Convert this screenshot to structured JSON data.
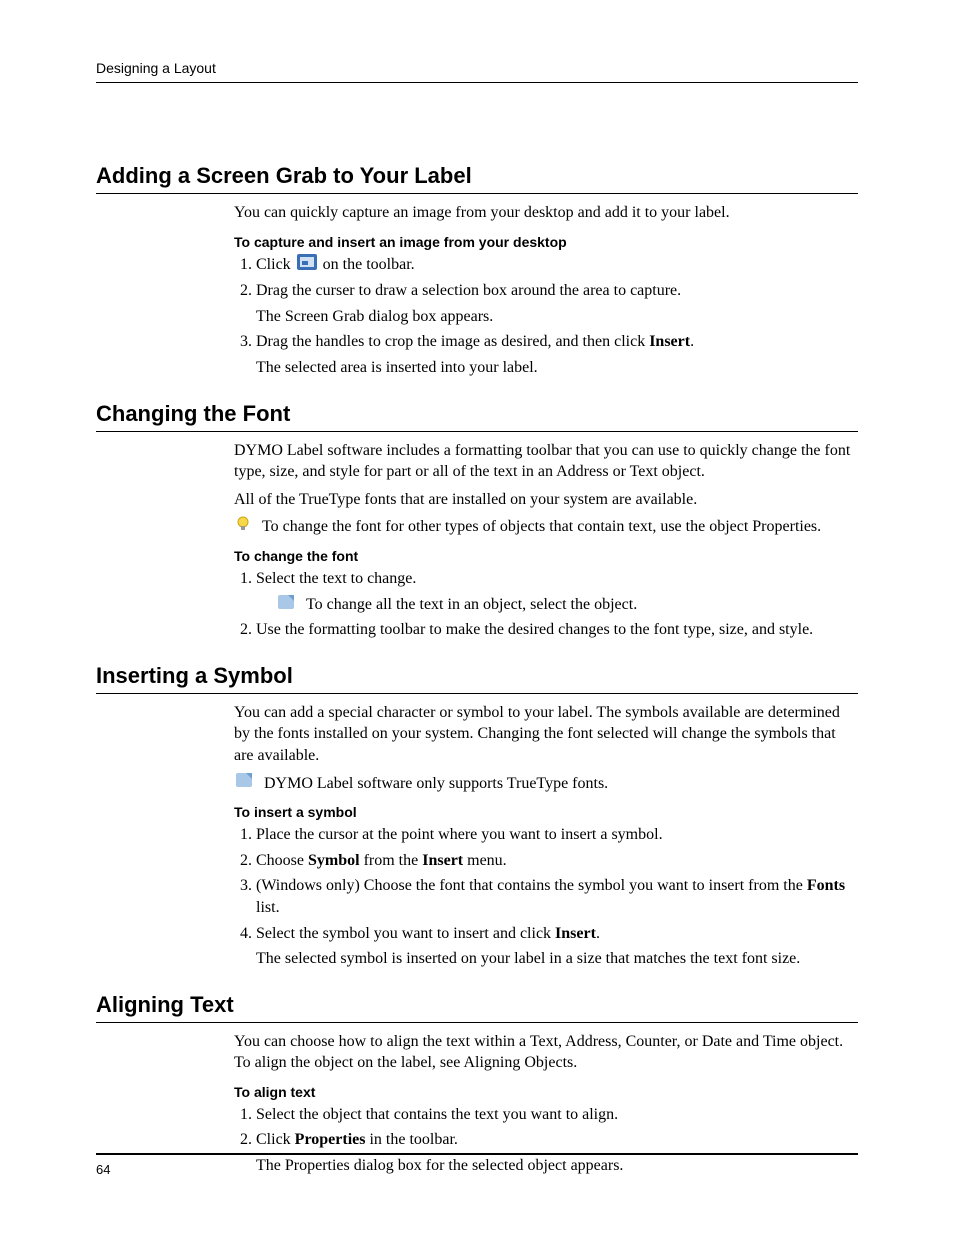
{
  "running_head": "Designing a Layout",
  "page_number": "64",
  "section1": {
    "title": "Adding a Screen Grab to Your Label",
    "intro": "You can quickly capture an image from your desktop and add it to your label.",
    "subhead": "To capture and insert an image from your desktop",
    "step1_a": "Click ",
    "step1_b": " on the toolbar.",
    "step2": "Drag the curser to draw a selection box around the area to capture.",
    "step2_result": "The Screen Grab dialog box appears.",
    "step3_a": "Drag the handles to crop the image as desired, and then click ",
    "step3_b": "Insert",
    "step3_c": ".",
    "step3_result": "The selected area is inserted into your label."
  },
  "section2": {
    "title": "Changing the Font",
    "intro1": "DYMO Label software includes a formatting toolbar that you can use to quickly change the font type, size, and style for part or all of the text in an Address or Text object.",
    "intro2": "All of the TrueType fonts that are installed on your system are available.",
    "tip": "To change the font for other types of objects that contain text, use the object Properties.",
    "subhead": "To change the font",
    "step1": "Select the text to change.",
    "step1_note": "To change all the text in an object, select the object.",
    "step2": "Use the formatting toolbar to make the desired changes to the font type, size, and style."
  },
  "section3": {
    "title": "Inserting a Symbol",
    "intro": "You can add a special character or symbol to your label. The symbols available are determined by the fonts installed on your system. Changing the font selected will change the symbols that are available.",
    "note": "DYMO Label software only supports TrueType fonts.",
    "subhead": "To insert a symbol",
    "step1": "Place the cursor at the point where you want to insert a symbol.",
    "step2_a": "Choose ",
    "step2_b": "Symbol",
    "step2_c": " from the ",
    "step2_d": "Insert",
    "step2_e": " menu.",
    "step3_a": "(Windows only) Choose the font that contains the symbol you want to insert from the ",
    "step3_b": "Fonts",
    "step3_c": " list.",
    "step4_a": "Select the symbol you want to insert and click ",
    "step4_b": "Insert",
    "step4_c": ".",
    "step4_result": "The selected symbol is inserted on your label in a size that matches the text font size."
  },
  "section4": {
    "title": "Aligning Text",
    "intro": "You can choose how to align the text within a Text, Address, Counter, or Date and Time object. To align the object on the label, see Aligning Objects.",
    "subhead": "To align text",
    "step1": "Select the object that contains the text you want to align.",
    "step2_a": "Click ",
    "step2_b": "Properties",
    "step2_c": " in the toolbar.",
    "step2_result": "The Properties dialog box for the selected object appears."
  }
}
